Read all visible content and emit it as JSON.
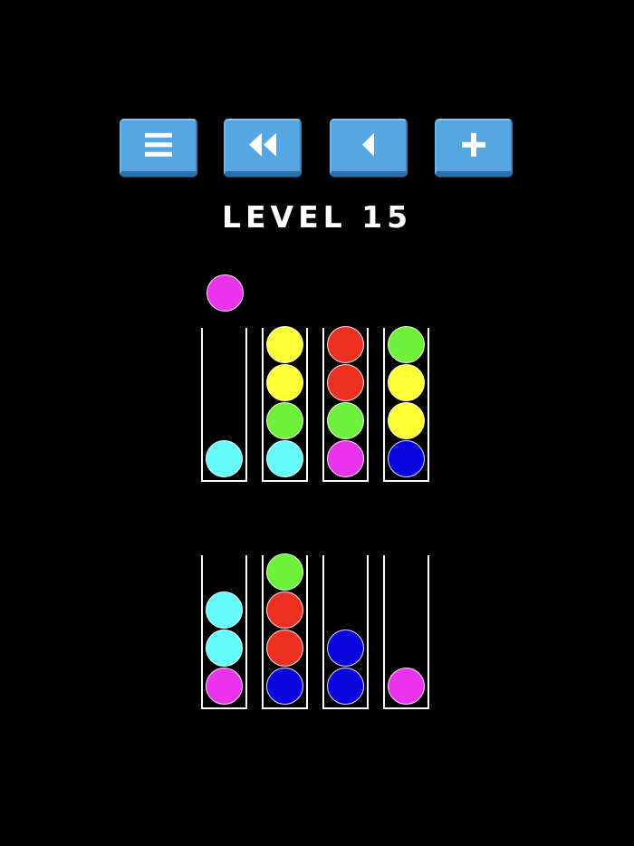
{
  "toolbar": {
    "buttons": [
      {
        "name": "menu-button",
        "icon": "menu-icon"
      },
      {
        "name": "restart-button",
        "icon": "rewind-icon"
      },
      {
        "name": "undo-button",
        "icon": "back-arrow-icon"
      },
      {
        "name": "add-tube-button",
        "icon": "plus-icon"
      }
    ],
    "button_color": "#55a6e2",
    "icon_color": "#ffffff"
  },
  "level": {
    "title": "LEVEL 15"
  },
  "colors": {
    "cyan": "#66fbfb",
    "yellow": "#ffff36",
    "red": "#ec3122",
    "green": "#6ff03b",
    "magenta": "#ea34eb",
    "blue": "#0a05dc"
  },
  "lifted_ball": {
    "color": "magenta",
    "from_tube": 1
  },
  "tubes": [
    {
      "row": 1,
      "balls": [
        "cyan"
      ]
    },
    {
      "row": 1,
      "balls": [
        "cyan",
        "green",
        "yellow",
        "yellow"
      ]
    },
    {
      "row": 1,
      "balls": [
        "magenta",
        "green",
        "red",
        "red"
      ]
    },
    {
      "row": 1,
      "balls": [
        "blue",
        "yellow",
        "yellow",
        "green"
      ]
    },
    {
      "row": 2,
      "balls": [
        "magenta",
        "cyan",
        "cyan"
      ]
    },
    {
      "row": 2,
      "balls": [
        "blue",
        "red",
        "red",
        "green"
      ]
    },
    {
      "row": 2,
      "balls": [
        "blue",
        "blue"
      ]
    },
    {
      "row": 2,
      "balls": [
        "magenta"
      ]
    }
  ]
}
